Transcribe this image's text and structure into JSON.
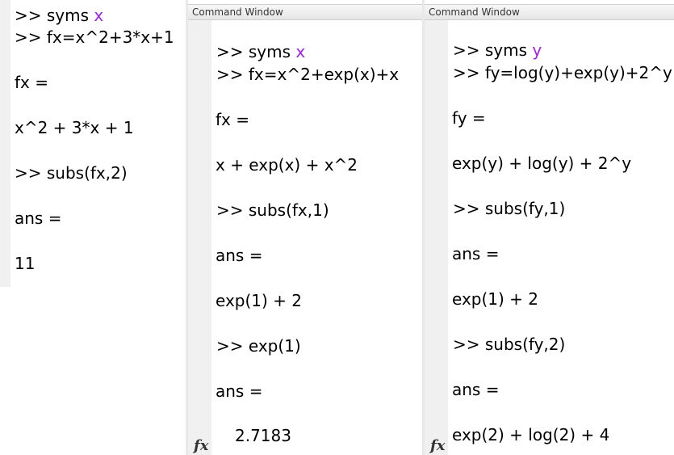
{
  "panes": [
    {
      "title": "",
      "lines": [
        {
          "prompt": ">> ",
          "cmd": "syms ",
          "kw": "x"
        },
        {
          "prompt": ">> ",
          "cmd": "fx=x^2+3*x+1"
        },
        {
          "text": "fx ="
        },
        {
          "text": "x^2 + 3*x + 1"
        },
        {
          "prompt": ">> ",
          "cmd": "subs(fx,2)"
        },
        {
          "text": "ans ="
        },
        {
          "text": "11"
        }
      ]
    },
    {
      "title": "Command Window",
      "lines": [
        {
          "prompt": ">> ",
          "cmd": "syms ",
          "kw": "x"
        },
        {
          "prompt": ">> ",
          "cmd": "fx=x^2+exp(x)+x"
        },
        {
          "text": "fx ="
        },
        {
          "text": "x + exp(x) + x^2"
        },
        {
          "prompt": ">> ",
          "cmd": "subs(fx,1)"
        },
        {
          "text": "ans ="
        },
        {
          "text": "exp(1) + 2"
        },
        {
          "prompt": ">> ",
          "cmd": "exp(1)"
        },
        {
          "text": "ans ="
        },
        {
          "text": "2.7183"
        }
      ],
      "fx_icon": "fx"
    },
    {
      "title": "Command Window",
      "lines": [
        {
          "prompt": ">> ",
          "cmd": "syms ",
          "kw": "y"
        },
        {
          "prompt": ">> ",
          "cmd": "fy=log(y)+exp(y)+2^y"
        },
        {
          "text": "fy ="
        },
        {
          "text": "exp(y) + log(y) + 2^y"
        },
        {
          "prompt": ">> ",
          "cmd": "subs(fy,1)"
        },
        {
          "text": "ans ="
        },
        {
          "text": "exp(1) + 2"
        },
        {
          "prompt": ">> ",
          "cmd": "subs(fy,2)"
        },
        {
          "text": "ans ="
        },
        {
          "text": "exp(2) + log(2) + 4"
        }
      ],
      "fx_icon": "fx"
    }
  ]
}
